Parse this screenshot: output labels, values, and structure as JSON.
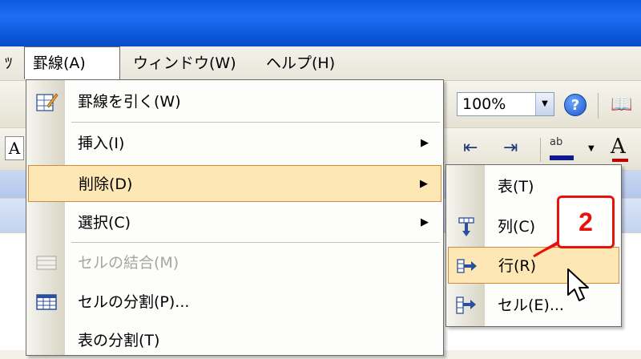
{
  "menubar": {
    "items": [
      {
        "label": "ﾂ"
      },
      {
        "label": "罫線(A)"
      },
      {
        "label": "ウィンドウ(W)"
      },
      {
        "label": "ヘルプ(H)"
      }
    ]
  },
  "toolbar": {
    "zoom_value": "100%",
    "help_glyph": "?",
    "left_a": "A",
    "font_color_a": "A",
    "highlight_glyph": "ab"
  },
  "menu": {
    "items": [
      {
        "label": "罫線を引く(W)",
        "icon": "draw-table-icon",
        "submenu": false
      },
      {
        "label": "挿入(I)",
        "icon": "",
        "submenu": true
      },
      {
        "label": "削除(D)",
        "icon": "",
        "submenu": true,
        "highlighted": true
      },
      {
        "label": "選択(C)",
        "icon": "",
        "submenu": true
      },
      {
        "label": "セルの結合(M)",
        "icon": "merge-cells-icon",
        "disabled": true
      },
      {
        "label": "セルの分割(P)...",
        "icon": "split-cells-icon"
      },
      {
        "label": "表の分割(T)",
        "icon": ""
      }
    ]
  },
  "submenu": {
    "items": [
      {
        "label": "表(T)",
        "icon": ""
      },
      {
        "label": "列(C)",
        "icon": "delete-column-icon"
      },
      {
        "label": "行(R)",
        "icon": "delete-row-icon",
        "highlighted": true
      },
      {
        "label": "セル(E)...",
        "icon": "delete-cell-icon"
      }
    ]
  },
  "annotation": {
    "step_number": "2",
    "color": "#e8120a"
  },
  "colors": {
    "highlight_bg": "#fde7b5",
    "highlight_border": "#d18b3c",
    "titlebar": "#0a5be0"
  }
}
